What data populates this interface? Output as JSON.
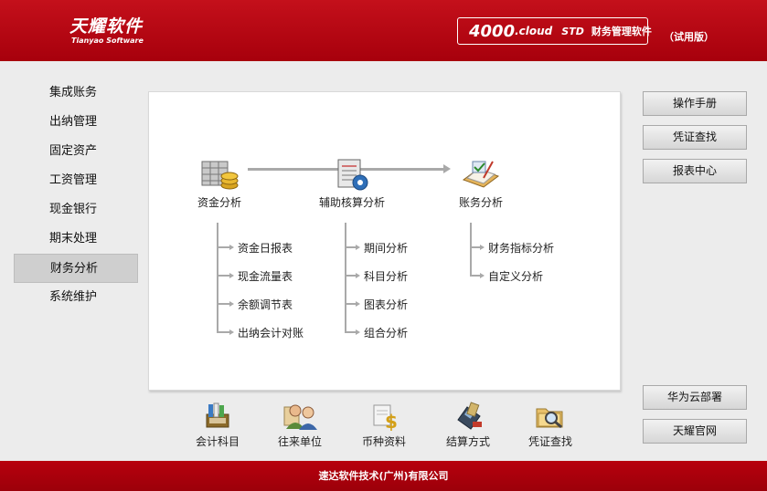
{
  "header": {
    "logo_main": "天耀软件",
    "logo_sub": "Tianyao Software",
    "version": "4000",
    "cloud": ".cloud",
    "edition": "STD",
    "product_name": "财务管理软件",
    "trial": "（试用版）"
  },
  "nav": {
    "items": [
      {
        "label": "集成账务"
      },
      {
        "label": "出纳管理"
      },
      {
        "label": "固定资产"
      },
      {
        "label": "工资管理"
      },
      {
        "label": "现金银行"
      },
      {
        "label": "期末处理"
      },
      {
        "label": "财务分析",
        "active": true
      },
      {
        "label": "系统维护"
      }
    ]
  },
  "flow": {
    "nodes": [
      {
        "label": "资金分析",
        "icon": "funds-analysis-icon"
      },
      {
        "label": "辅助核算分析",
        "icon": "auxiliary-accounting-icon"
      },
      {
        "label": "账务分析",
        "icon": "account-analysis-icon"
      }
    ],
    "funds_sub": [
      "资金日报表",
      "现金流量表",
      "余额调节表",
      "出纳会计对账"
    ],
    "aux_sub": [
      "期间分析",
      "科目分析",
      "图表分析",
      "组合分析"
    ],
    "account_sub": [
      "财务指标分析",
      "自定义分析"
    ]
  },
  "shortcuts": [
    {
      "label": "会计科目",
      "icon": "account-subject-icon"
    },
    {
      "label": "往来单位",
      "icon": "contacts-icon"
    },
    {
      "label": "币种资料",
      "icon": "currency-icon"
    },
    {
      "label": "结算方式",
      "icon": "settlement-icon"
    },
    {
      "label": "凭证查找",
      "icon": "voucher-search-icon"
    }
  ],
  "right_buttons": {
    "manual": "操作手册",
    "voucher_search": "凭证查找",
    "report_center": "报表中心",
    "huawei_cloud": "华为云部署",
    "official_site": "天耀官网"
  },
  "footer": {
    "company": "速达软件技术(广州)有限公司"
  },
  "colors": {
    "brand_red": "#b5000e",
    "background": "#ececec"
  }
}
